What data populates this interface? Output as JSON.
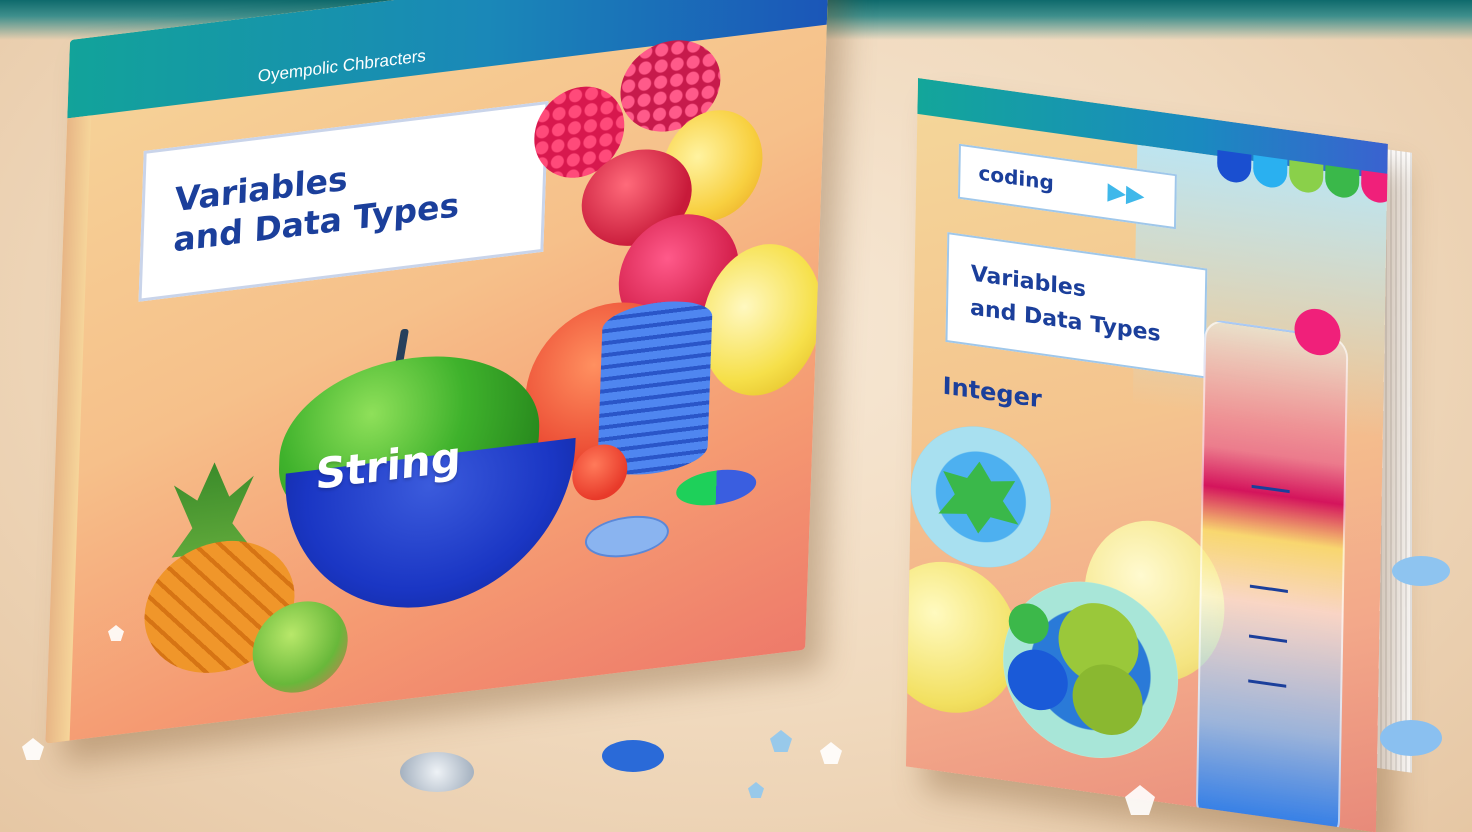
{
  "left_book": {
    "series": "Oyempolic Chbracters",
    "title_line1": "Variables",
    "title_line2": "and Data Types",
    "label": "String"
  },
  "right_book": {
    "tag": "coding",
    "tag_icon": "fast-forward-icon",
    "title_line1": "Variables",
    "title_line2": "and Data Types",
    "label": "Integer",
    "swatch_colors": [
      "#1a4fd0",
      "#2ab0f0",
      "#8ad04a",
      "#3ab84a",
      "#f0207a"
    ]
  },
  "colors": {
    "title_text": "#1b3f9b",
    "band_teal": "#12a39a",
    "band_blue": "#1b56b8"
  }
}
